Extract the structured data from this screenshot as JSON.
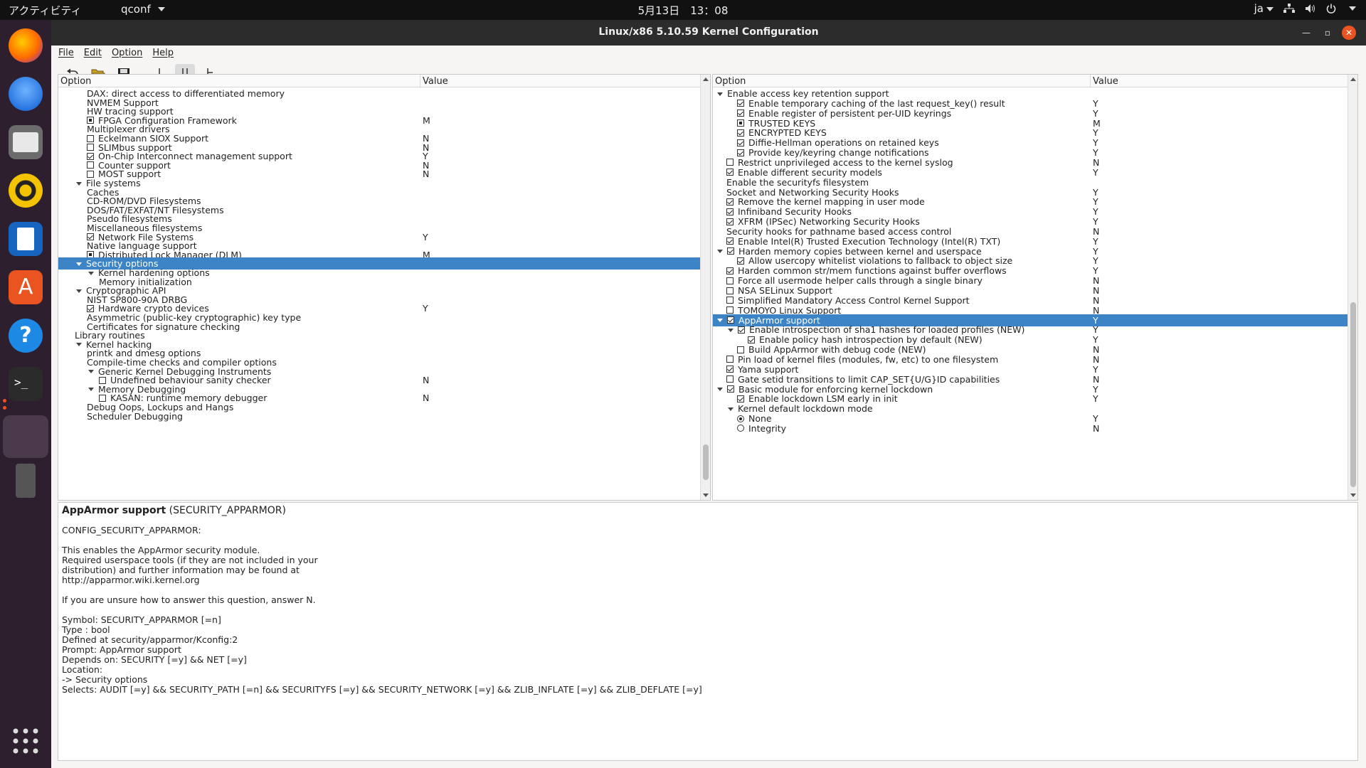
{
  "topbar": {
    "activities": "アクティビティ",
    "app": "qconf",
    "clock": "5月13日　13：08",
    "lang": "ja"
  },
  "window": {
    "title": "Linux/x86 5.10.59 Kernel Configuration"
  },
  "menu": [
    "File",
    "Edit",
    "Option",
    "Help"
  ],
  "left": {
    "col_option": "Option",
    "col_value": "Value",
    "rows": [
      {
        "indent": 2,
        "type": "none",
        "label": "DAX: direct access to differentiated memory",
        "value": ""
      },
      {
        "indent": 2,
        "type": "none",
        "label": "NVMEM Support",
        "value": ""
      },
      {
        "indent": 2,
        "type": "none",
        "label": "HW tracing support",
        "value": ""
      },
      {
        "indent": 2,
        "type": "mod",
        "label": "FPGA Configuration Framework",
        "value": "M"
      },
      {
        "indent": 2,
        "type": "none",
        "label": "Multiplexer drivers",
        "value": ""
      },
      {
        "indent": 2,
        "type": "cb",
        "label": "Eckelmann SIOX Support",
        "value": "N"
      },
      {
        "indent": 2,
        "type": "cb",
        "label": "SLIMbus support",
        "value": "N"
      },
      {
        "indent": 2,
        "type": "cbc",
        "label": "On-Chip Interconnect management support",
        "value": "Y"
      },
      {
        "indent": 2,
        "type": "cb",
        "label": "Counter support",
        "value": "N"
      },
      {
        "indent": 2,
        "type": "cb",
        "label": "MOST support",
        "value": "N"
      },
      {
        "indent": 1,
        "type": "tri",
        "label": "File systems",
        "value": ""
      },
      {
        "indent": 2,
        "type": "none",
        "label": "Caches",
        "value": ""
      },
      {
        "indent": 2,
        "type": "none",
        "label": "CD-ROM/DVD Filesystems",
        "value": ""
      },
      {
        "indent": 2,
        "type": "none",
        "label": "DOS/FAT/EXFAT/NT Filesystems",
        "value": ""
      },
      {
        "indent": 2,
        "type": "none",
        "label": "Pseudo filesystems",
        "value": ""
      },
      {
        "indent": 2,
        "type": "none",
        "label": "Miscellaneous filesystems",
        "value": ""
      },
      {
        "indent": 2,
        "type": "cbc",
        "label": "Network File Systems",
        "value": "Y"
      },
      {
        "indent": 2,
        "type": "none",
        "label": "Native language support",
        "value": ""
      },
      {
        "indent": 2,
        "type": "mod",
        "label": "Distributed Lock Manager (DLM)",
        "value": "M"
      },
      {
        "indent": 1,
        "type": "tri",
        "label": "Security options",
        "value": "",
        "selected": true
      },
      {
        "indent": 2,
        "type": "tri",
        "label": "Kernel hardening options",
        "value": ""
      },
      {
        "indent": 3,
        "type": "none",
        "label": "Memory initialization",
        "value": ""
      },
      {
        "indent": 1,
        "type": "tri",
        "label": "Cryptographic API",
        "value": ""
      },
      {
        "indent": 2,
        "type": "none",
        "label": "NIST SP800-90A DRBG",
        "value": ""
      },
      {
        "indent": 2,
        "type": "cbc",
        "label": "Hardware crypto devices",
        "value": "Y"
      },
      {
        "indent": 2,
        "type": "none",
        "label": "Asymmetric (public-key cryptographic) key type",
        "value": ""
      },
      {
        "indent": 2,
        "type": "none",
        "label": "Certificates for signature checking",
        "value": ""
      },
      {
        "indent": 1,
        "type": "none",
        "label": "Library routines",
        "value": ""
      },
      {
        "indent": 1,
        "type": "tri",
        "label": "Kernel hacking",
        "value": ""
      },
      {
        "indent": 2,
        "type": "none",
        "label": "printk and dmesg options",
        "value": ""
      },
      {
        "indent": 2,
        "type": "none",
        "label": "Compile-time checks and compiler options",
        "value": ""
      },
      {
        "indent": 2,
        "type": "tri",
        "label": "Generic Kernel Debugging Instruments",
        "value": ""
      },
      {
        "indent": 3,
        "type": "cb",
        "label": "Undefined behaviour sanity checker",
        "value": "N"
      },
      {
        "indent": 2,
        "type": "tri",
        "label": "Memory Debugging",
        "value": ""
      },
      {
        "indent": 3,
        "type": "cb",
        "label": "KASAN: runtime memory debugger",
        "value": "N"
      },
      {
        "indent": 2,
        "type": "none",
        "label": "Debug Oops, Lockups and Hangs",
        "value": ""
      },
      {
        "indent": 2,
        "type": "none",
        "label": "Scheduler Debugging",
        "value": ""
      }
    ]
  },
  "right": {
    "col_option": "Option",
    "col_value": "Value",
    "rows": [
      {
        "indent": 0,
        "type": "tri",
        "label": "Enable access key retention support",
        "value": ""
      },
      {
        "indent": 2,
        "type": "cbc",
        "label": "Enable temporary caching of the last request_key() result",
        "value": "Y"
      },
      {
        "indent": 2,
        "type": "cbc",
        "label": "Enable register of persistent per-UID keyrings",
        "value": "Y"
      },
      {
        "indent": 2,
        "type": "mod",
        "label": "TRUSTED KEYS",
        "value": "M"
      },
      {
        "indent": 2,
        "type": "cbc",
        "label": "ENCRYPTED KEYS",
        "value": "Y"
      },
      {
        "indent": 2,
        "type": "cbc",
        "label": "Diffie-Hellman operations on retained keys",
        "value": "Y"
      },
      {
        "indent": 2,
        "type": "cbc",
        "label": "Provide key/keyring change notifications",
        "value": "Y"
      },
      {
        "indent": 1,
        "type": "cb",
        "label": "Restrict unprivileged access to the kernel syslog",
        "value": "N"
      },
      {
        "indent": 1,
        "type": "cbc",
        "label": "Enable different security models",
        "value": "Y"
      },
      {
        "indent": 1,
        "type": "none",
        "label": "Enable the securityfs filesystem",
        "value": ""
      },
      {
        "indent": 1,
        "type": "none",
        "label": "Socket and Networking Security Hooks",
        "value": "Y"
      },
      {
        "indent": 1,
        "type": "cbc",
        "label": "Remove the kernel mapping in user mode",
        "value": "Y"
      },
      {
        "indent": 1,
        "type": "cbc",
        "label": "Infiniband Security Hooks",
        "value": "Y"
      },
      {
        "indent": 1,
        "type": "cbc",
        "label": "XFRM (IPSec) Networking Security Hooks",
        "value": "Y"
      },
      {
        "indent": 1,
        "type": "none",
        "label": "Security hooks for pathname based access control",
        "value": "N"
      },
      {
        "indent": 1,
        "type": "cbc",
        "label": "Enable Intel(R) Trusted Execution Technology (Intel(R) TXT)",
        "value": "Y"
      },
      {
        "indent": 0,
        "type": "tricb",
        "label": "Harden memory copies between kernel and userspace",
        "value": "Y"
      },
      {
        "indent": 2,
        "type": "cbc",
        "label": "Allow usercopy whitelist violations to fallback to object size",
        "value": "Y"
      },
      {
        "indent": 1,
        "type": "cbc",
        "label": "Harden common str/mem functions against buffer overflows",
        "value": "Y"
      },
      {
        "indent": 1,
        "type": "cb",
        "label": "Force all usermode helper calls through a single binary",
        "value": "N"
      },
      {
        "indent": 1,
        "type": "cb",
        "label": "NSA SELinux Support",
        "value": "N"
      },
      {
        "indent": 1,
        "type": "cb",
        "label": "Simplified Mandatory Access Control Kernel Support",
        "value": "N"
      },
      {
        "indent": 1,
        "type": "cb",
        "label": "TOMOYO Linux Support",
        "value": "N"
      },
      {
        "indent": 0,
        "type": "tricb",
        "label": "AppArmor support",
        "value": "Y",
        "selected": true
      },
      {
        "indent": 1,
        "type": "tricb",
        "label": "Enable introspection of sha1 hashes for loaded profiles (NEW)",
        "value": "Y"
      },
      {
        "indent": 3,
        "type": "cbc",
        "label": "Enable policy hash introspection by default (NEW)",
        "value": "Y"
      },
      {
        "indent": 2,
        "type": "cb",
        "label": "Build AppArmor with debug code (NEW)",
        "value": "N"
      },
      {
        "indent": 1,
        "type": "cb",
        "label": "Pin load of kernel files (modules, fw, etc) to one filesystem",
        "value": "N"
      },
      {
        "indent": 1,
        "type": "cbc",
        "label": "Yama support",
        "value": "Y"
      },
      {
        "indent": 1,
        "type": "cb",
        "label": "Gate setid transitions to limit CAP_SET{U/G}ID capabilities",
        "value": "N"
      },
      {
        "indent": 0,
        "type": "tricb",
        "label": "Basic module for enforcing kernel lockdown",
        "value": "Y"
      },
      {
        "indent": 2,
        "type": "cbc",
        "label": "Enable lockdown LSM early in init",
        "value": "Y"
      },
      {
        "indent": 1,
        "type": "tri",
        "label": "Kernel default lockdown mode",
        "value": ""
      },
      {
        "indent": 2,
        "type": "rbc",
        "label": "None",
        "value": "Y"
      },
      {
        "indent": 2,
        "type": "rb",
        "label": "Integrity",
        "value": "N"
      }
    ]
  },
  "help": {
    "title": "AppArmor support",
    "symbol_paren": "(SECURITY_APPARMOR)",
    "lines": [
      "",
      "CONFIG_SECURITY_APPARMOR:",
      "",
      "This enables the AppArmor security module.",
      "Required userspace tools (if they are not included in your",
      "distribution) and further information may be found at",
      "http://apparmor.wiki.kernel.org",
      "",
      "If you are unsure how to answer this question, answer N.",
      "",
      "Symbol: SECURITY_APPARMOR [=n]",
      "Type : bool",
      "Defined at security/apparmor/Kconfig:2",
      "Prompt: AppArmor support",
      "Depends on: SECURITY [=y] && NET [=y]",
      "Location:",
      "-> Security options",
      "Selects: AUDIT [=y] && SECURITY_PATH [=n] && SECURITYFS [=y] && SECURITY_NETWORK [=y] && ZLIB_INFLATE [=y] && ZLIB_DEFLATE [=y]"
    ]
  },
  "colors": {
    "selection": "#3d84c6",
    "titlebar": "#2c2c2c",
    "close": "#e95420",
    "dock": "#2d1f2e"
  }
}
